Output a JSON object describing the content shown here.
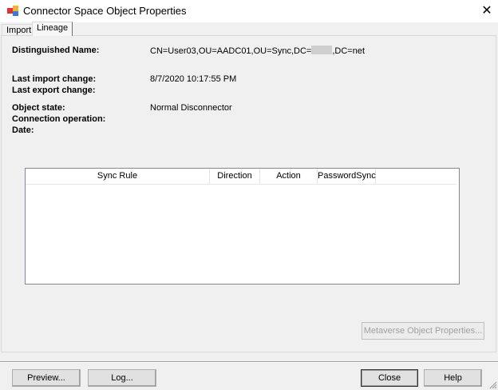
{
  "window": {
    "title": "Connector Space Object Properties",
    "close": "✕"
  },
  "tabs": [
    {
      "label": "Import"
    },
    {
      "label": "Lineage"
    }
  ],
  "fields": {
    "dn_label": "Distinguished Name:",
    "dn_prefix": "CN=User03,OU=AADC01,OU=Sync,DC=",
    "dn_suffix": ",DC=net",
    "last_import_label": "Last import change:",
    "last_import_value": "8/7/2020 10:17:55 PM",
    "last_export_label": "Last export change:",
    "object_state_label": "Object state:",
    "object_state_value": "Normal Disconnector",
    "connection_operation_label": "Connection operation:",
    "date_label": "Date:"
  },
  "grid": {
    "columns": [
      "Sync Rule",
      "Direction",
      "Action",
      "PasswordSync"
    ],
    "rows": []
  },
  "buttons": {
    "metaverse": "Metaverse Object Properties...",
    "preview": "Preview...",
    "log": "Log...",
    "close": "Close",
    "help": "Help"
  }
}
